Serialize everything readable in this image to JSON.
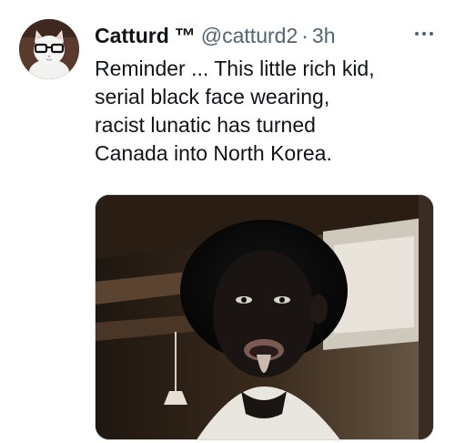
{
  "tweet": {
    "display_name": "Catturd",
    "badge": "™",
    "handle": "@catturd2",
    "separator": "·",
    "time": "3h",
    "more_icon": "more-horizontal-icon",
    "text": "Reminder ... This little rich kid,\nserial black face wearing,\nracist lunatic has turned\nCanada into North Korea.",
    "avatar": "cat-with-glasses-avatar",
    "media": "video-still-photo"
  },
  "colors": {
    "primary_text": "#0f1419",
    "secondary_text": "#536471",
    "border": "#cfd9de",
    "background": "#ffffff"
  }
}
